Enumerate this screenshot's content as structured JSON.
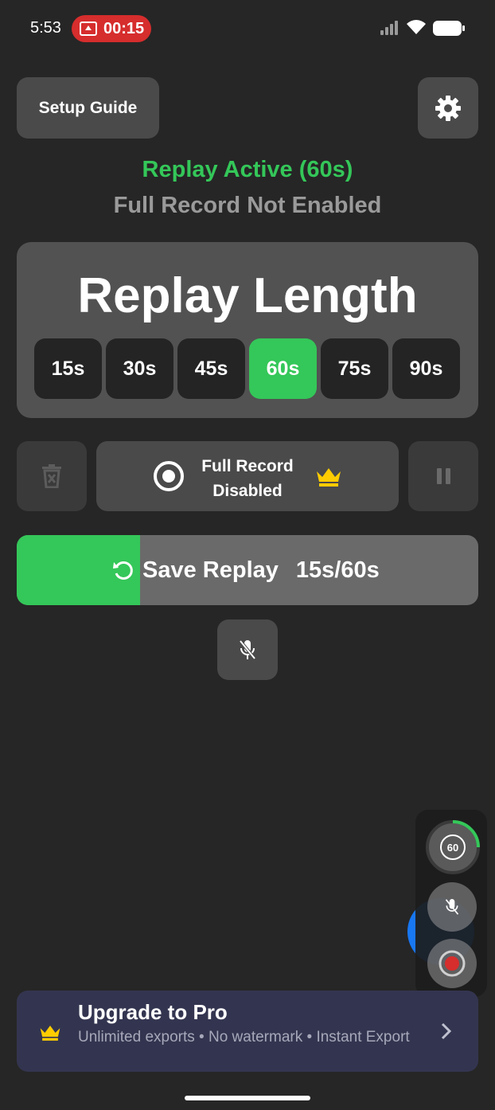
{
  "status_bar": {
    "time": "5:53",
    "recording_timer": "00:15",
    "icons": [
      "screen-cast-icon",
      "signal-icon",
      "wifi-icon",
      "battery-icon"
    ]
  },
  "header": {
    "setup_guide_label": "Setup Guide",
    "settings_icon": "gear-icon"
  },
  "status": {
    "replay": "Replay Active (60s)",
    "full_record": "Full Record Not Enabled"
  },
  "replay_length": {
    "title": "Replay Length",
    "options": [
      "15s",
      "30s",
      "45s",
      "60s",
      "75s",
      "90s"
    ],
    "selected": "60s"
  },
  "actions": {
    "full_record_label": "Full Record Disabled",
    "icons": [
      "trash-icon",
      "record-icon",
      "crown-icon",
      "pause-icon"
    ]
  },
  "save_replay": {
    "label": "Save Replay",
    "count": "15s/60s",
    "progress_fraction": 0.25,
    "icon": "replay-icon"
  },
  "floating_widget": {
    "timer_label": "60",
    "icons": [
      "replay-timer-icon",
      "mic-off-icon",
      "record-icon"
    ]
  },
  "upgrade": {
    "title": "Upgrade to Pro",
    "subtitle": "Unlimited exports • No watermark • Instant Export",
    "icons": [
      "crown-icon",
      "chevron-right-icon"
    ]
  },
  "colors": {
    "background": "#262626",
    "accent_green": "#34c759",
    "gold": "#ffcc00",
    "record_red": "#d62d2d",
    "upgrade_bg": "#333550"
  }
}
